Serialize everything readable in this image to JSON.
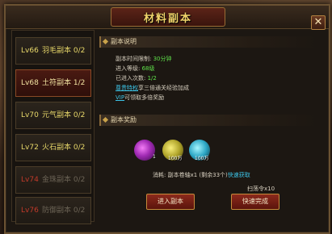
{
  "window": {
    "title": "材料副本",
    "close_label": "✕"
  },
  "dungeons": [
    {
      "level": "Lv66",
      "name": "羽毛副本 0/2",
      "state": "available"
    },
    {
      "level": "Lv68",
      "name": "土符副本 1/2",
      "state": "selected"
    },
    {
      "level": "Lv70",
      "name": "元气副本 0/2",
      "state": "available"
    },
    {
      "level": "Lv72",
      "name": "火石副本 0/2",
      "state": "available"
    },
    {
      "level": "Lv74",
      "name": "金珠副本 0/2",
      "state": "locked"
    },
    {
      "level": "Lv76",
      "name": "防御副本 0/2",
      "state": "locked"
    }
  ],
  "description": {
    "header": "副本说明",
    "time_limit_label": "副本时间限制: ",
    "time_limit_value": "30分钟",
    "entry_level_label": "进入等级: ",
    "entry_level_value": "68级",
    "entered_label": "已进入次数: ",
    "entered_value": "1/2",
    "privilege_link": "尊贵特权",
    "privilege_text": "享三倍通关经验加成",
    "vip_link": "VIP",
    "vip_text": "可领取多倍奖励"
  },
  "rewards": {
    "header": "副本奖励",
    "items": [
      {
        "icon": "purple-orb-icon",
        "qty": "1"
      },
      {
        "icon": "gold-exp-orb-icon",
        "qty": "100万"
      },
      {
        "icon": "blue-orb-icon",
        "qty": "100万"
      }
    ],
    "cost_text": "消耗: 副本卷轴x1 (剩余33个)",
    "quick_get": "快速获取",
    "sweep_text": "扫荡令x10"
  },
  "buttons": {
    "enter": "进入副本",
    "quick_finish": "快速完成"
  },
  "colors": {
    "accent_gold": "#f2d36a",
    "value_green": "#5fe04a",
    "link_cyan": "#3cc3e6",
    "locked_red": "#c23a2a",
    "button_red": "#8c2a1c"
  }
}
